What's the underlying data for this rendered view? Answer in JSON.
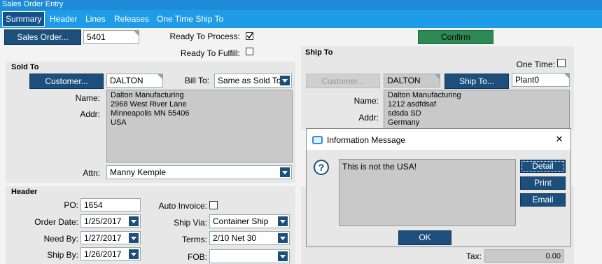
{
  "window": {
    "title": "Sales Order Entry"
  },
  "tabs": [
    "Summary",
    "Header",
    "Lines",
    "Releases",
    "One Time Ship To"
  ],
  "top": {
    "sales_order_button": "Sales Order...",
    "sales_order_value": "5401",
    "ready_to_process_label": "Ready To Process:",
    "ready_to_process_checked": true,
    "ready_to_fulfill_label": "Ready To Fulfill:",
    "ready_to_fulfill_checked": false,
    "confirm_button": "Confirm"
  },
  "sold_to": {
    "section_title": "Sold To",
    "customer_button": "Customer...",
    "customer_value": "DALTON",
    "bill_to_label": "Bill To:",
    "bill_to_value": "Same as Sold To",
    "name_label": "Name:",
    "addr_label": "Addr:",
    "address_text": "Dalton Manufacturing\n2968 West River Lane\nMinneapolis MN 55406\nUSA",
    "attn_label": "Attn:",
    "attn_value": "Manny Kemple"
  },
  "ship_to": {
    "section_title": "Ship To",
    "one_time_label": "One Time:",
    "customer_button": "Customer...",
    "customer_value": "DALTON",
    "ship_to_button": "Ship To...",
    "ship_to_value": "Plant0",
    "name_label": "Name:",
    "addr_label": "Addr:",
    "address_text": "Dalton Manufacturing\n1212 asdfdsaf\nsdsda SD\nGermany"
  },
  "header": {
    "section_title": "Header",
    "po_label": "PO:",
    "po_value": "1654",
    "order_date_label": "Order Date:",
    "order_date_value": "1/25/2017",
    "need_by_label": "Need By:",
    "need_by_value": "1/27/2017",
    "ship_by_label": "Ship By:",
    "ship_by_value": "1/26/2017",
    "auto_invoice_label": "Auto Invoice:",
    "ship_via_label": "Ship Via:",
    "ship_via_value": "Container Ship",
    "terms_label": "Terms:",
    "terms_value": "2/10 Net 30",
    "fob_label": "FOB:",
    "fob_value": ""
  },
  "totals": {
    "tax_label": "Tax:",
    "tax_value": "0.00"
  },
  "dialog": {
    "title": "Information Message",
    "message": "This is not the USA!",
    "detail_button": "Detail",
    "print_button": "Print",
    "email_button": "Email",
    "ok_button": "OK",
    "close_glyph": "✕",
    "question_glyph": "?"
  }
}
